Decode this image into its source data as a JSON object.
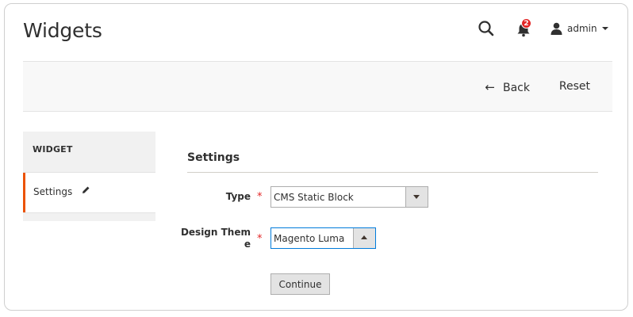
{
  "header": {
    "title": "Widgets",
    "notifications_count": "2",
    "user_name": "admin"
  },
  "actions": {
    "back_label": "Back",
    "reset_label": "Reset"
  },
  "sidebar": {
    "title": "WIDGET",
    "items": [
      {
        "label": "Settings",
        "active": true
      }
    ]
  },
  "form": {
    "section_title": "Settings",
    "type_label": "Type",
    "type_value": "CMS Static Block",
    "theme_label_line1": "Design Them",
    "theme_label_line2": "e",
    "theme_value": "Magento Luma",
    "required_mark": "*",
    "continue_label": "Continue"
  },
  "colors": {
    "accent": "#eb5202",
    "required": "#e22626",
    "focus": "#007bdb"
  },
  "icons": {
    "search": "search-icon",
    "notifications": "bell-icon",
    "user": "user-icon",
    "back": "arrow-left-icon",
    "edit": "pencil-icon"
  }
}
